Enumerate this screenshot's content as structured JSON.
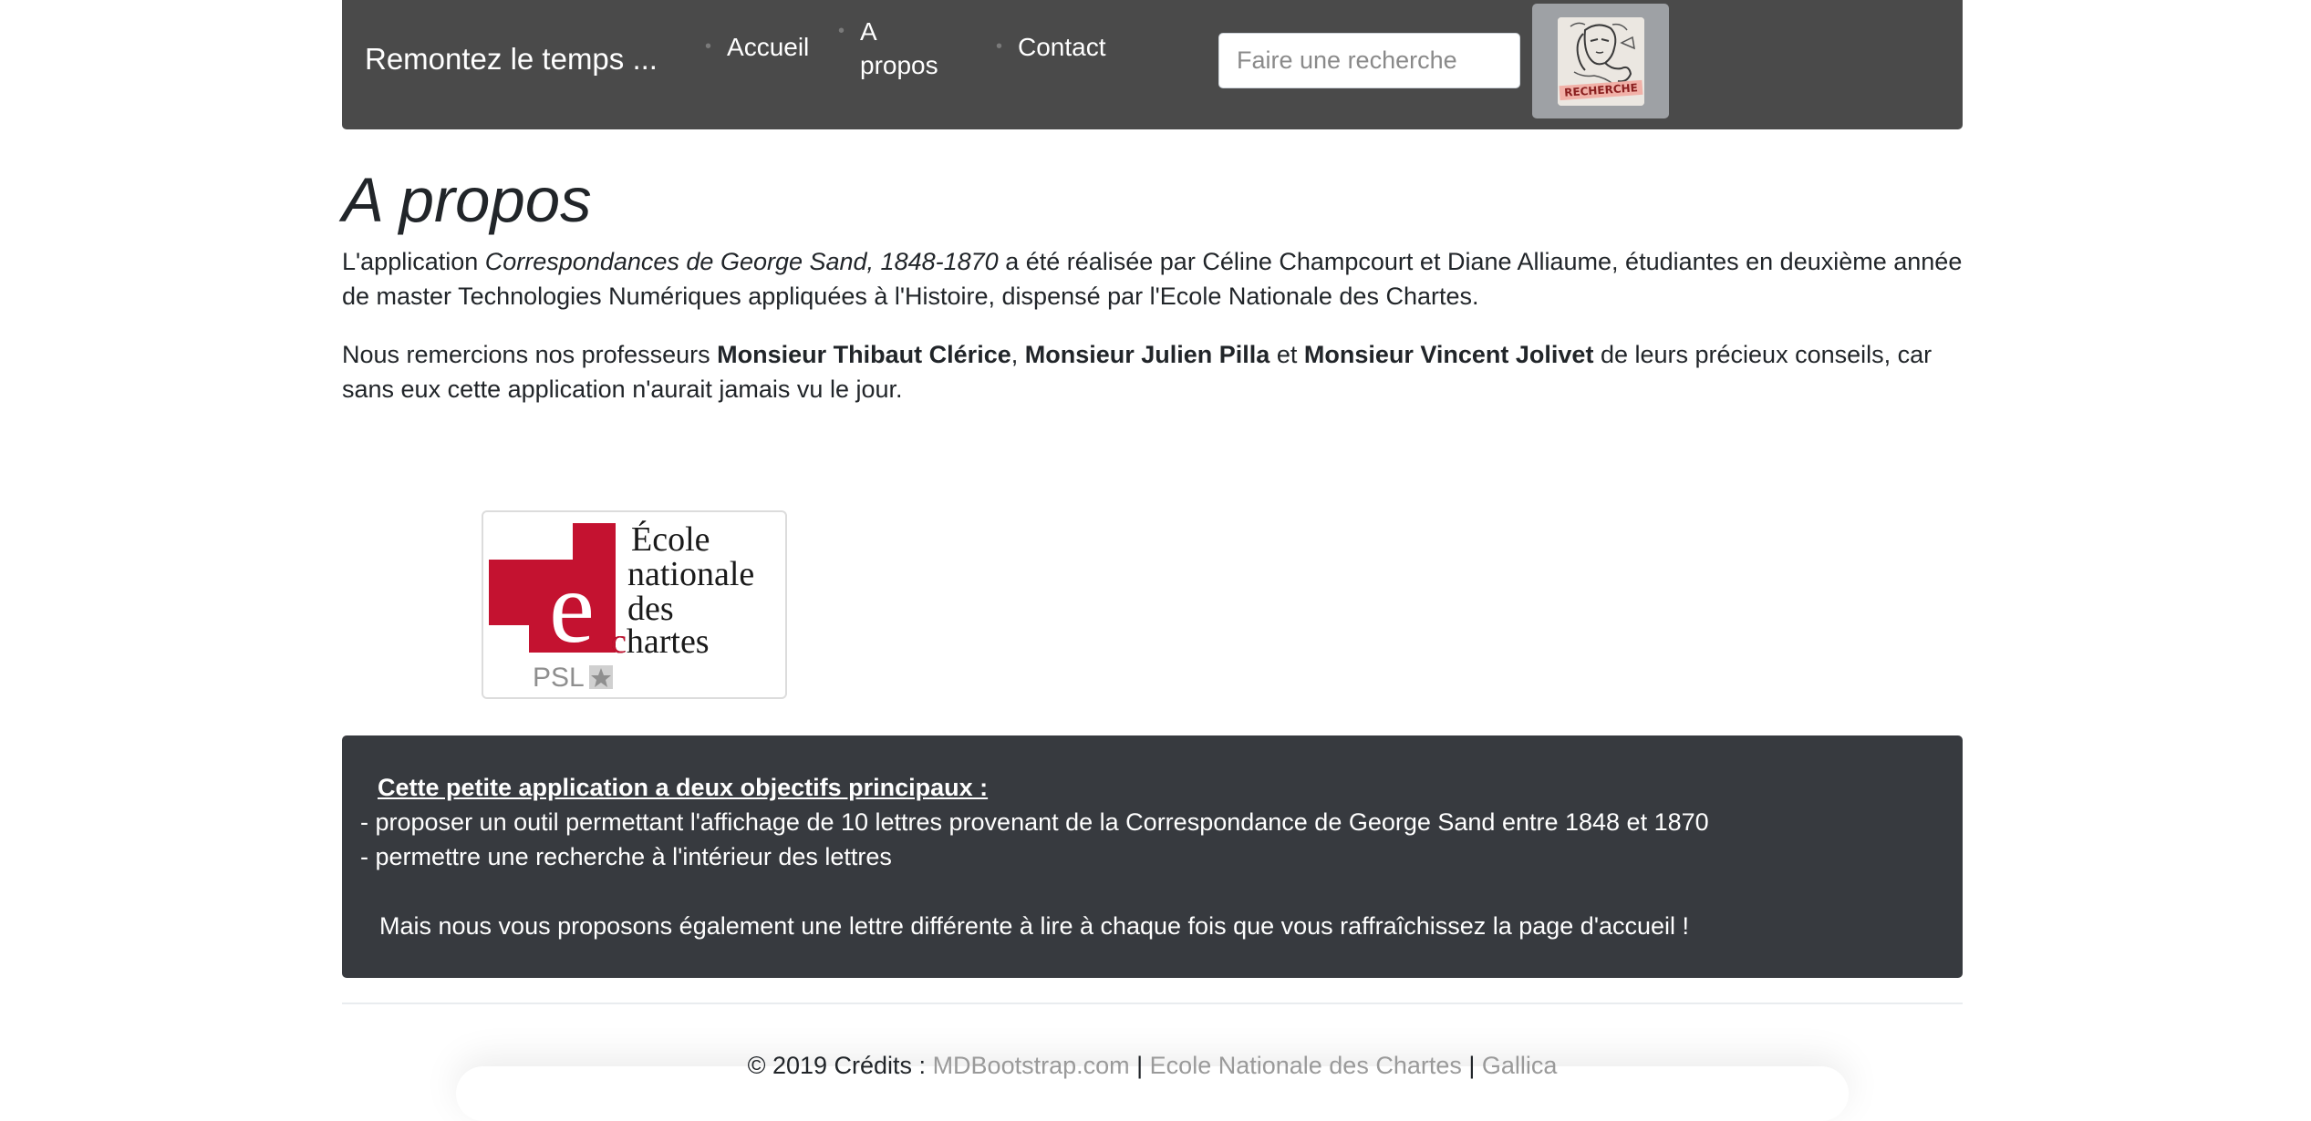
{
  "navbar": {
    "brand": "Remontez le temps ...",
    "items": [
      {
        "label": "Accueil"
      },
      {
        "label": "A propos"
      },
      {
        "label": "Contact"
      }
    ],
    "search": {
      "placeholder": "Faire une recherche"
    },
    "search_button": {
      "label": "RECHERCHE",
      "icon": "search-stamp-icon"
    }
  },
  "main": {
    "title": "A propos",
    "paragraph1": {
      "prefix": "L'application ",
      "italic": "Correspondances de George Sand, 1848-1870",
      "suffix": " a été réalisée par Céline Champcourt et Diane Alliaume, étudiantes en deuxième année de master Technologies Numériques appliquées à l'Histoire, dispensé par l'Ecole Nationale des Chartes."
    },
    "paragraph2": {
      "prefix": "Nous remercions nos professeurs ",
      "name1": "Monsieur Thibaut Clérice",
      "sep1": ", ",
      "name2": "Monsieur Julien Pilla",
      "sep2": " et ",
      "name3": "Monsieur Vincent Jolivet",
      "suffix": " de leurs précieux conseils, car sans eux cette application n'aurait jamais vu le jour."
    },
    "logo": {
      "line1": "École",
      "line2": "nationale",
      "line3": "des",
      "line4": "chartes",
      "mark": "PSL",
      "brand_color": "#c41230"
    }
  },
  "info": {
    "title": "Cette petite application a deux objectifs principaux :",
    "line1": "- proposer un outil permettant l'affichage de 10 lettres provenant de la Correspondance de George Sand entre 1848 et 1870",
    "line2": "- permettre une recherche à l'intérieur des lettres",
    "line3": "Mais nous vous proposons également une lettre différente à lire à chaque fois que vous raffraîchissez la page d'accueil !"
  },
  "footer": {
    "prefix": "© 2019 Crédits : ",
    "link1": "MDBootstrap.com",
    "sep1": " | ",
    "link2": "Ecole Nationale des Chartes",
    "sep2": " | ",
    "link3": "Gallica"
  }
}
